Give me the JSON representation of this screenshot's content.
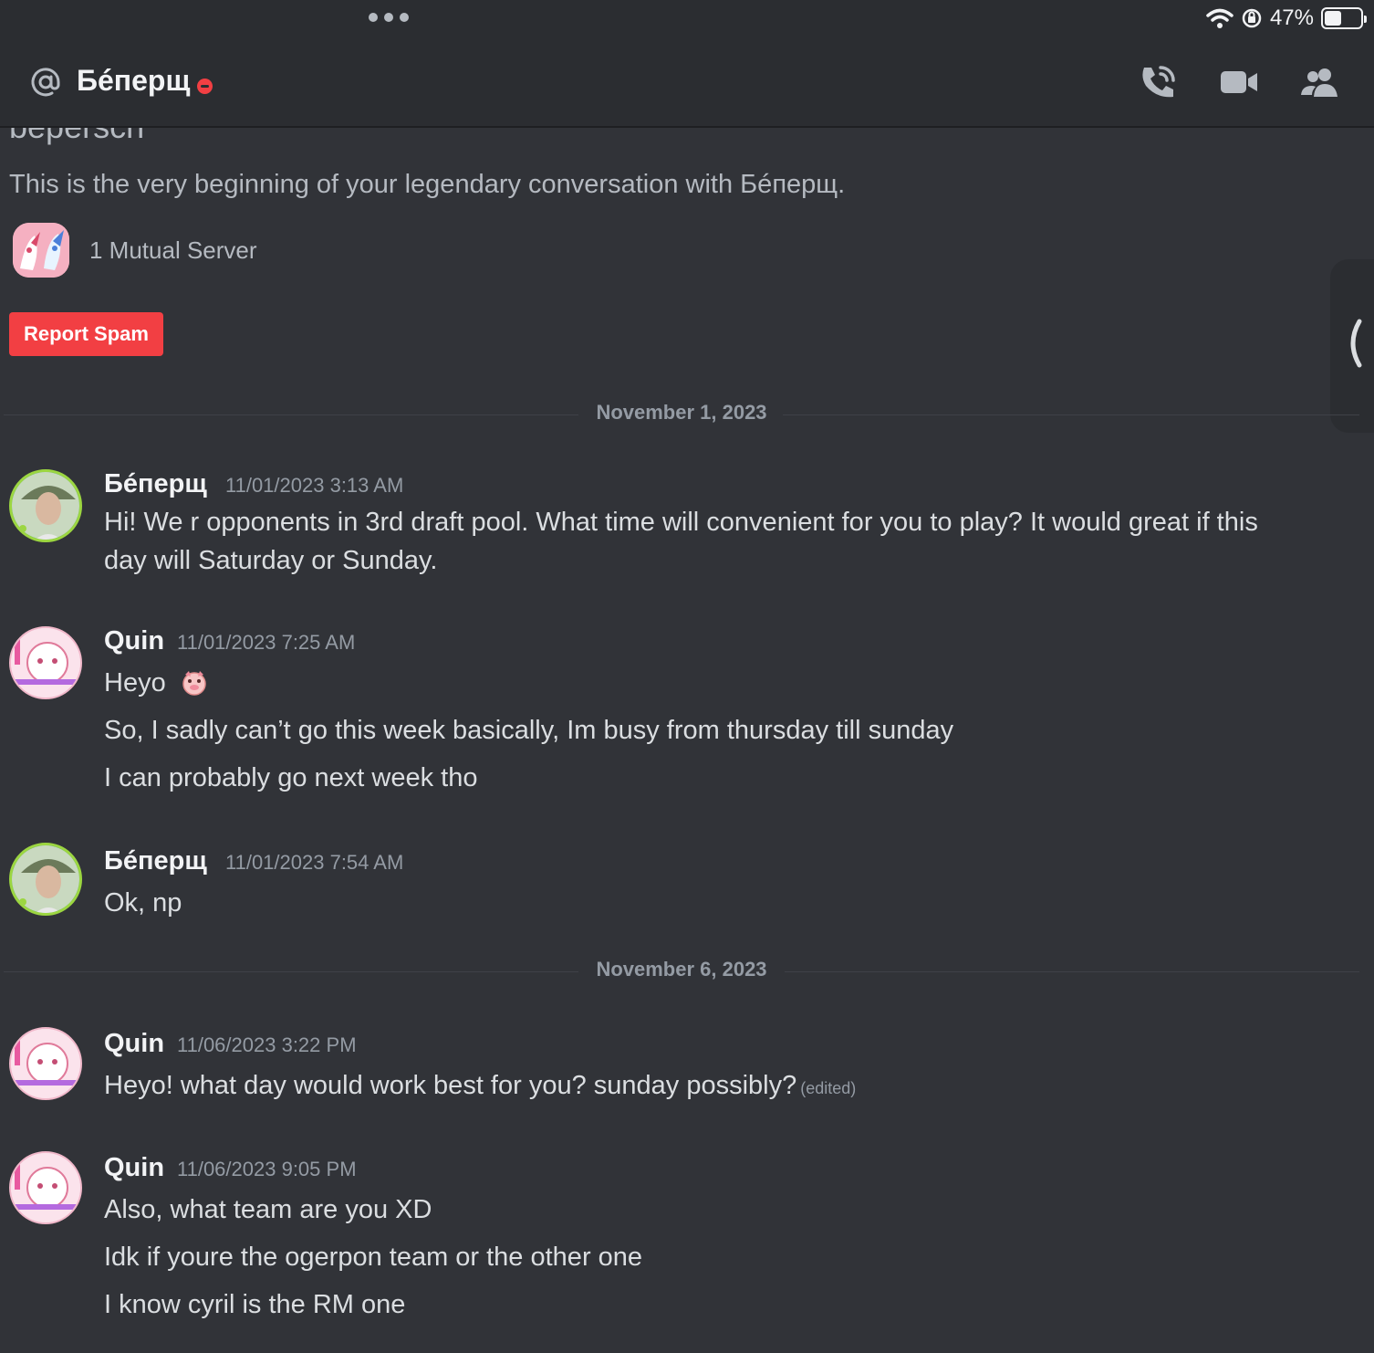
{
  "status_bar": {
    "battery_percent": "47%",
    "battery_level": 0.47
  },
  "header": {
    "title": "Бéперщ"
  },
  "intro": {
    "handle": "beperscn",
    "text": "This is the very beginning of your legendary conversation with Бéперщ.",
    "mutual_servers": "1 Mutual Server",
    "report_button": "Report Spam"
  },
  "dividers": [
    "November 1, 2023",
    "November 6, 2023"
  ],
  "messages": [
    {
      "author": "Бéперщ",
      "timestamp": "11/01/2023 3:13 AM",
      "lines": [
        "Hi! We r opponents in 3rd draft pool. What time will convenient for you to play? It would great if this",
        "day will Saturday or Sunday."
      ]
    },
    {
      "author": "Quin",
      "timestamp": "11/01/2023 7:25 AM",
      "lines": [
        "Heyo",
        "So, I sadly can’t go this week basically, Im busy from thursday till sunday",
        "I can probably go next week tho"
      ]
    },
    {
      "author": "Бéперщ",
      "timestamp": "11/01/2023 7:54 AM",
      "lines": [
        "Ok, np"
      ]
    },
    {
      "author": "Quin",
      "timestamp": "11/06/2023 3:22 PM",
      "lines": [
        "Heyo! what day would work best for you? sunday possibly?"
      ],
      "edited": "(edited)"
    },
    {
      "author": "Quin",
      "timestamp": "11/06/2023 9:05 PM",
      "lines": [
        "Also, what team are you XD",
        "Idk if youre the ogerpon team or the other one",
        "I know cyril is the RM one"
      ]
    }
  ]
}
